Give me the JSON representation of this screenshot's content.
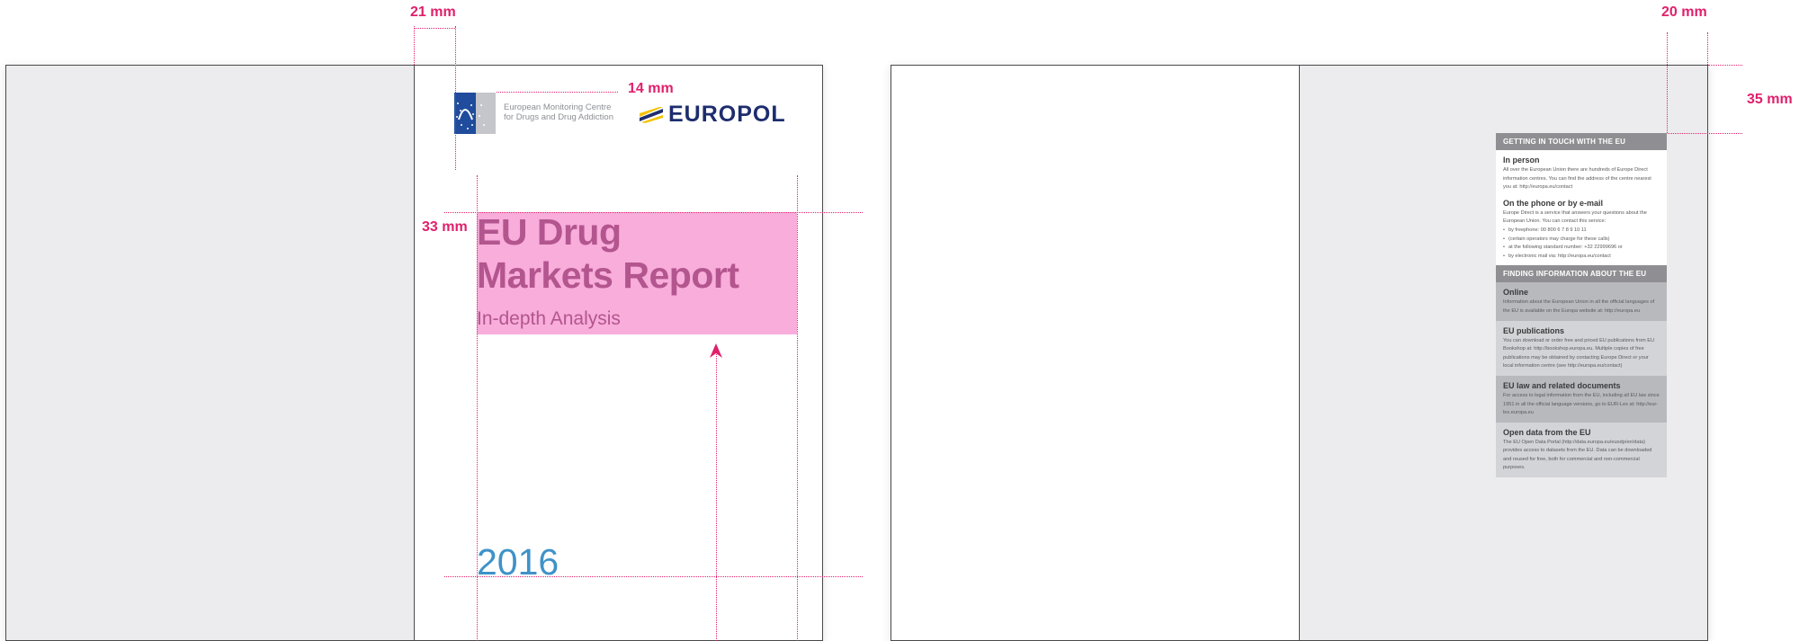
{
  "dimensions": {
    "left_margin": "21 mm",
    "logo_gap": "14 mm",
    "title_top": "33 mm",
    "right_margin": "20 mm",
    "right_top": "35 mm"
  },
  "cover": {
    "emcdda_text_line1": "European Monitoring Centre",
    "emcdda_text_line2": "for Drugs and Drug Addiction",
    "europol_word": "EUROPOL",
    "title_line1": "EU Drug",
    "title_line2": "Markets Report",
    "subtitle": "In-depth Analysis",
    "year": "2016"
  },
  "back_cover": {
    "getting_in_touch": {
      "header": "GETTING IN TOUCH WITH THE EU",
      "in_person_title": "In person",
      "in_person_text": "All over the European Union there are hundreds of Europe Direct information centres. You can find the address of the centre nearest you at: http://europa.eu/contact",
      "phone_title": "On the phone or by e-mail",
      "phone_text": "Europe Direct is a service that answers your questions about the European Union. You can contact this service:",
      "phone_items": [
        "by freephone: 00 800 6 7 8 9 10 11",
        "(certain operators may charge for these calls)",
        "at the following standard number: +32 22999696 or",
        "by electronic mail via: http://europa.eu/contact"
      ]
    },
    "finding_info": {
      "header": "FINDING INFORMATION ABOUT THE EU",
      "online_title": "Online",
      "online_text": "Information about the European Union in all the official languages of the EU is available on the Europa website at: http://europa.eu",
      "pubs_title": "EU publications",
      "pubs_text": "You can download or order free and priced EU publications from EU Bookshop at: http://bookshop.europa.eu. Multiple copies of free publications may be obtained by contacting Europe Direct or your local information centre (see http://europa.eu/contact)",
      "law_title": "EU law and related documents",
      "law_text": "For access to legal information from the EU, including all EU law since 1951 in all the official language versions, go to EUR-Lex at: http://eur-lex.europa.eu",
      "open_title": "Open data from the EU",
      "open_text": "The EU Open Data Portal (http://data.europa.eu/euodp/en/data) provides access to datasets from the EU. Data can be downloaded and reused for free, both for commercial and non-commercial purposes."
    }
  },
  "colors": {
    "guide": "#e0206c",
    "title_pink": "#b3558e",
    "box_pink": "#f8addb",
    "year_blue": "#3f92c8"
  }
}
